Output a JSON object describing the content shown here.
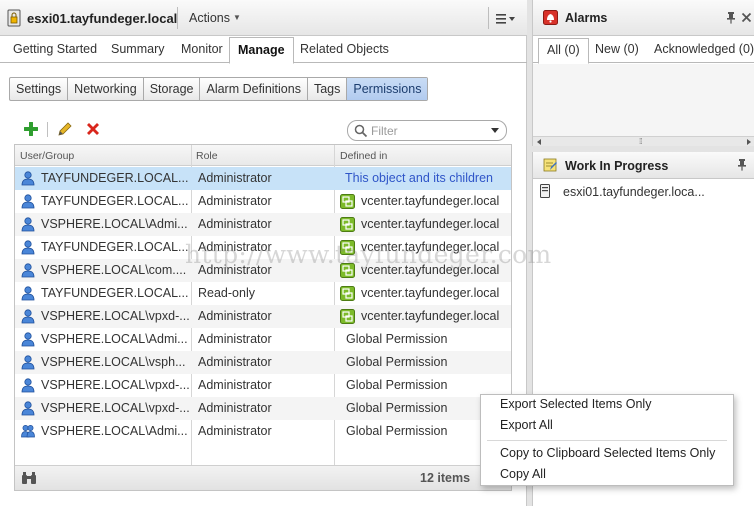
{
  "main_panel": {
    "host_name": "esxi01.tayfundeger.local",
    "actions_label": "Actions",
    "tabs": [
      {
        "label": "Getting Started",
        "active": false
      },
      {
        "label": "Summary",
        "active": false
      },
      {
        "label": "Monitor",
        "active": false
      },
      {
        "label": "Manage",
        "active": true
      },
      {
        "label": "Related Objects",
        "active": false
      }
    ],
    "sub_tabs": [
      {
        "label": "Settings",
        "active": false
      },
      {
        "label": "Networking",
        "active": false
      },
      {
        "label": "Storage",
        "active": false
      },
      {
        "label": "Alarm Definitions",
        "active": false
      },
      {
        "label": "Tags",
        "active": false
      },
      {
        "label": "Permissions",
        "active": true
      }
    ],
    "toolbar": {
      "add_icon": "add-permission-icon",
      "edit_icon": "edit-permission-icon",
      "delete_icon": "delete-permission-icon"
    },
    "filter": {
      "placeholder": "Filter",
      "value": ""
    }
  },
  "permissions_grid": {
    "columns": [
      "User/Group",
      "Role",
      "Defined in"
    ],
    "rows": [
      {
        "user": "TAYFUNDEGER.LOCAL...",
        "role": "Administrator",
        "defined_in": "This object and its children",
        "defined_icon": "none",
        "selected": true
      },
      {
        "user": "TAYFUNDEGER.LOCAL...",
        "role": "Administrator",
        "defined_in": "vcenter.tayfundeger.local",
        "defined_icon": "vcenter-icon",
        "selected": false
      },
      {
        "user": "VSPHERE.LOCAL\\Admi...",
        "role": "Administrator",
        "defined_in": "vcenter.tayfundeger.local",
        "defined_icon": "vcenter-icon",
        "selected": false
      },
      {
        "user": "TAYFUNDEGER.LOCAL...",
        "role": "Administrator",
        "defined_in": "vcenter.tayfundeger.local",
        "defined_icon": "vcenter-icon",
        "selected": false
      },
      {
        "user": "VSPHERE.LOCAL\\com....",
        "role": "Administrator",
        "defined_in": "vcenter.tayfundeger.local",
        "defined_icon": "vcenter-icon",
        "selected": false
      },
      {
        "user": "TAYFUNDEGER.LOCAL...",
        "role": "Read-only",
        "defined_in": "vcenter.tayfundeger.local",
        "defined_icon": "vcenter-icon",
        "selected": false
      },
      {
        "user": "VSPHERE.LOCAL\\vpxd-...",
        "role": "Administrator",
        "defined_in": "vcenter.tayfundeger.local",
        "defined_icon": "vcenter-icon",
        "selected": false
      },
      {
        "user": "VSPHERE.LOCAL\\Admi...",
        "role": "Administrator",
        "defined_in": "Global Permission",
        "defined_icon": "none",
        "selected": false
      },
      {
        "user": "VSPHERE.LOCAL\\vsph...",
        "role": "Administrator",
        "defined_in": "Global Permission",
        "defined_icon": "none",
        "selected": false
      },
      {
        "user": "VSPHERE.LOCAL\\vpxd-...",
        "role": "Administrator",
        "defined_in": "Global Permission",
        "defined_icon": "none",
        "selected": false
      },
      {
        "user": "VSPHERE.LOCAL\\vpxd-...",
        "role": "Administrator",
        "defined_in": "Global Permission",
        "defined_icon": "none",
        "selected": false
      },
      {
        "user": "VSPHERE.LOCAL\\Admi...",
        "role": "Administrator",
        "defined_in": "Global Permission",
        "defined_icon": "none",
        "selected": false,
        "user_icon": "group-icon"
      }
    ],
    "footer": {
      "items_count": "12 items"
    }
  },
  "alarms_panel": {
    "title": "Alarms",
    "tabs": [
      {
        "label": "All (0)",
        "active": true
      },
      {
        "label": "New (0)",
        "active": false
      },
      {
        "label": "Acknowledged (0)",
        "active": false
      }
    ]
  },
  "work_in_progress": {
    "title": "Work In Progress",
    "items": [
      {
        "label": "esxi01.tayfundeger.loca..."
      }
    ]
  },
  "watermark": "http://www.tayfundeger.com",
  "context_menu": {
    "items": [
      "Export Selected Items Only",
      "Export All",
      "Copy to Clipboard Selected Items Only",
      "Copy All"
    ]
  },
  "colors": {
    "selected_row": "#c7e2f8",
    "active_subtab": "#b2cbef",
    "link_text": "#2f55c8",
    "vcenter_icon": "#7dbb2a",
    "delete_icon": "#d9261c",
    "add_icon": "#2f9e2f"
  }
}
